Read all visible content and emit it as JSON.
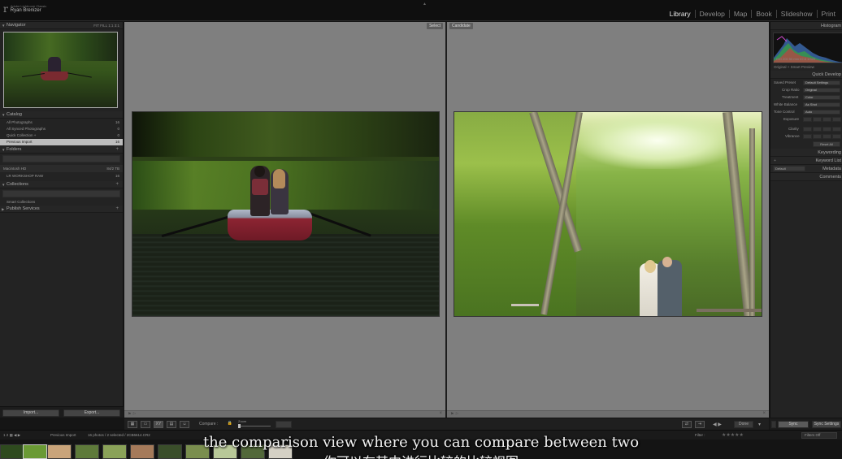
{
  "app": {
    "brand_small": "Adobe Lightroom Classic",
    "brand_name": "Ryan Brenizer"
  },
  "modules": [
    "Library",
    "Develop",
    "Map",
    "Book",
    "Slideshow",
    "Print"
  ],
  "active_module": "Library",
  "left": {
    "navigator": {
      "title": "Navigator",
      "zoom": "FIT FILL 1:1 3:1"
    },
    "catalog": {
      "title": "Catalog",
      "rows": [
        {
          "label": "All Photographs",
          "count": "16"
        },
        {
          "label": "All Synced Photographs",
          "count": "0"
        },
        {
          "label": "Quick Collection +",
          "count": "0"
        },
        {
          "label": "Previous Import",
          "count": "16"
        }
      ],
      "selected_index": 3
    },
    "folders": {
      "title": "Folders",
      "volume": {
        "label": "Macintosh HD",
        "info": "84/2 TB"
      },
      "folder": {
        "label": "LR WORKSHOP RAW",
        "count": "16"
      }
    },
    "collections": {
      "title": "Collections",
      "smart": "Smart Collections"
    },
    "publish": {
      "title": "Publish Services"
    },
    "import_label": "Import...",
    "export_label": "Export..."
  },
  "compare": {
    "select_label": "Select",
    "candidate_label": "Candidate"
  },
  "toolbar": {
    "compare_label": "Compare :",
    "zoom_label": "Zoom",
    "done_label": "Done"
  },
  "right": {
    "histogram": {
      "title": "Histogram",
      "info": "ISO 200   50 mm   f/2.8   1/320",
      "original": "Original + Smart Preview"
    },
    "quick_develop": {
      "title": "Quick Develop",
      "saved_preset_label": "Saved Preset",
      "saved_preset_value": "Default Settings",
      "crop_ratio_label": "Crop Ratio",
      "crop_ratio_value": "Original",
      "treatment_label": "Treatment",
      "treatment_value": "Color",
      "white_balance_label": "White Balance",
      "white_balance_value": "As Shot",
      "tone_control_label": "Tone Control",
      "auto_label": "Auto",
      "exposure_label": "Exposure",
      "clarity_label": "Clarity",
      "vibrance_label": "Vibrance",
      "reset_label": "Reset All"
    },
    "keywording": "Keywording",
    "keyword_list": "Keyword List",
    "keyword_default": "Default",
    "metadata": "Metadata",
    "comments": "Comments",
    "sync_label": "Sync",
    "sync_settings_label": "Sync Settings"
  },
  "filmbar": {
    "source": "Previous Import",
    "info": "16 photos / 2 selected / 2CB6614.CR2",
    "filter_label": "Filter :",
    "filters_off": "Filters Off"
  },
  "subtitle": {
    "en": "the comparison view where you can compare between two",
    "zh": "你可以在其中进行比较的比较视图"
  },
  "colors": {
    "bg": "#232323",
    "compare_bg": "#7f7f7f",
    "selected_row": "#bdbdbd"
  }
}
